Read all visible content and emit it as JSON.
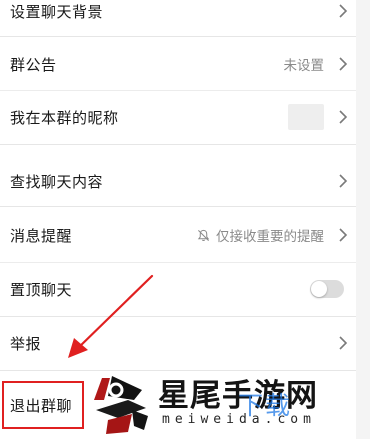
{
  "settings": {
    "items": [
      {
        "label": "设置聊天背景"
      },
      {
        "label": "群公告",
        "value": "未设置"
      },
      {
        "label": "我在本群的昵称"
      },
      {
        "label": "查找聊天内容"
      },
      {
        "label": "消息提醒",
        "value": "仅接收重要的提醒"
      },
      {
        "label": "置顶聊天",
        "toggle": false
      },
      {
        "label": "举报"
      }
    ],
    "exit_label": "退出群聊"
  },
  "watermark": {
    "title": "星尾手游网",
    "url": "meiweida.com",
    "overlay": "下载"
  },
  "colors": {
    "annotation": "#e02020",
    "divider": "#ececec",
    "secondary_text": "#8a8a8a"
  }
}
